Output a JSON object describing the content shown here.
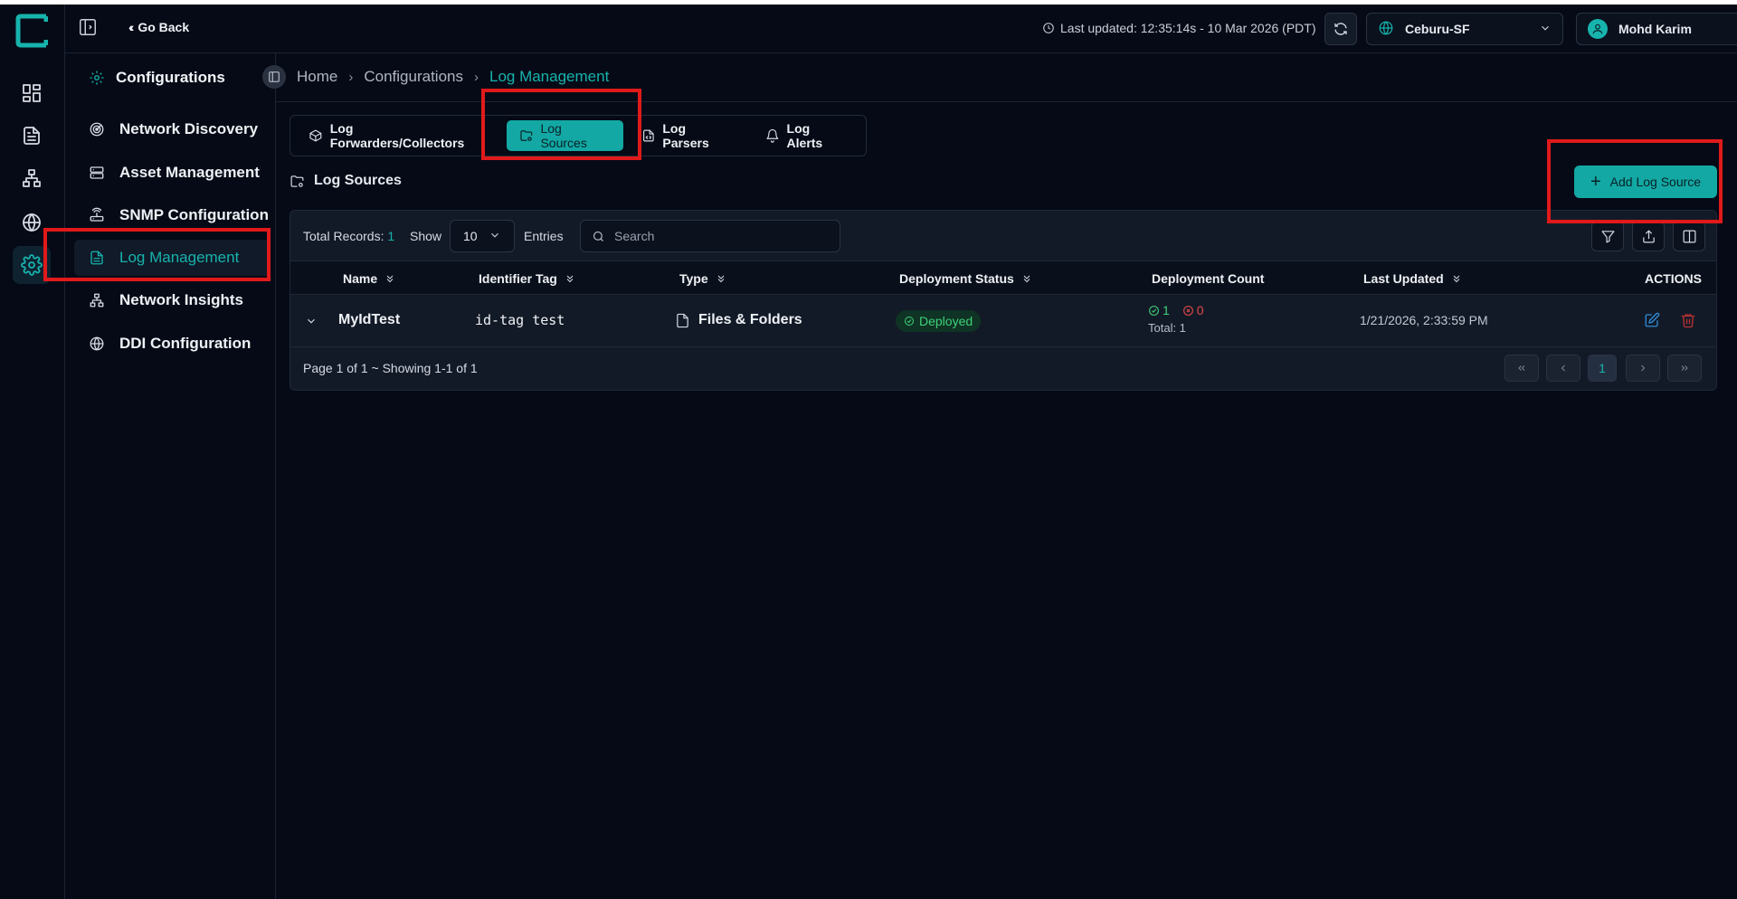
{
  "header": {
    "go_back": "Go Back",
    "last_updated": "Last updated: 12:35:14s - 10 Mar 2026 (PDT)",
    "site": "Ceburu-SF",
    "user": "Mohd Karim"
  },
  "subnav": {
    "title": "Configurations",
    "items": [
      {
        "label": "Network Discovery",
        "icon": "radar-icon"
      },
      {
        "label": "Asset Management",
        "icon": "server-icon"
      },
      {
        "label": "SNMP Configuration",
        "icon": "router-icon"
      },
      {
        "label": "Log Management",
        "icon": "file-text-icon",
        "active": true
      },
      {
        "label": "Network Insights",
        "icon": "network-icon"
      },
      {
        "label": "DDI Configuration",
        "icon": "globe-icon"
      }
    ]
  },
  "breadcrumb": [
    "Home",
    "Configurations",
    "Log Management"
  ],
  "tabs": [
    {
      "label": "Log Forwarders/Collectors",
      "icon": "box-icon"
    },
    {
      "label": "Log Sources",
      "icon": "folder-settings-icon",
      "active": true
    },
    {
      "label": "Log Parsers",
      "icon": "file-code-icon"
    },
    {
      "label": "Log Alerts",
      "icon": "bell-icon"
    }
  ],
  "section": {
    "title": "Log Sources",
    "add_button": "Add Log Source"
  },
  "toolbar": {
    "total_label": "Total Records:",
    "total_value": "1",
    "show_label": "Show",
    "show_value": "10",
    "entries_label": "Entries",
    "search_placeholder": "Search"
  },
  "table": {
    "columns": [
      "Name",
      "Identifier Tag",
      "Type",
      "Deployment Status",
      "Deployment Count",
      "Last Updated",
      "ACTIONS"
    ],
    "rows": [
      {
        "name": "MyIdTest",
        "identifier_tag": "id-tag test",
        "type": "Files & Folders",
        "status": "Deployed",
        "deploy_ok": "1",
        "deploy_fail": "0",
        "deploy_total": "Total: 1",
        "last_updated": "1/21/2026, 2:33:59 PM"
      }
    ]
  },
  "pagination": {
    "info": "Page 1 of 1 ~ Showing 1-1 of 1",
    "current_page": "1"
  },
  "colors": {
    "accent": "#13a8a3",
    "background": "#050a16",
    "success": "#3fd27a",
    "danger": "#e34a4a",
    "highlight": "#e01a1a"
  }
}
